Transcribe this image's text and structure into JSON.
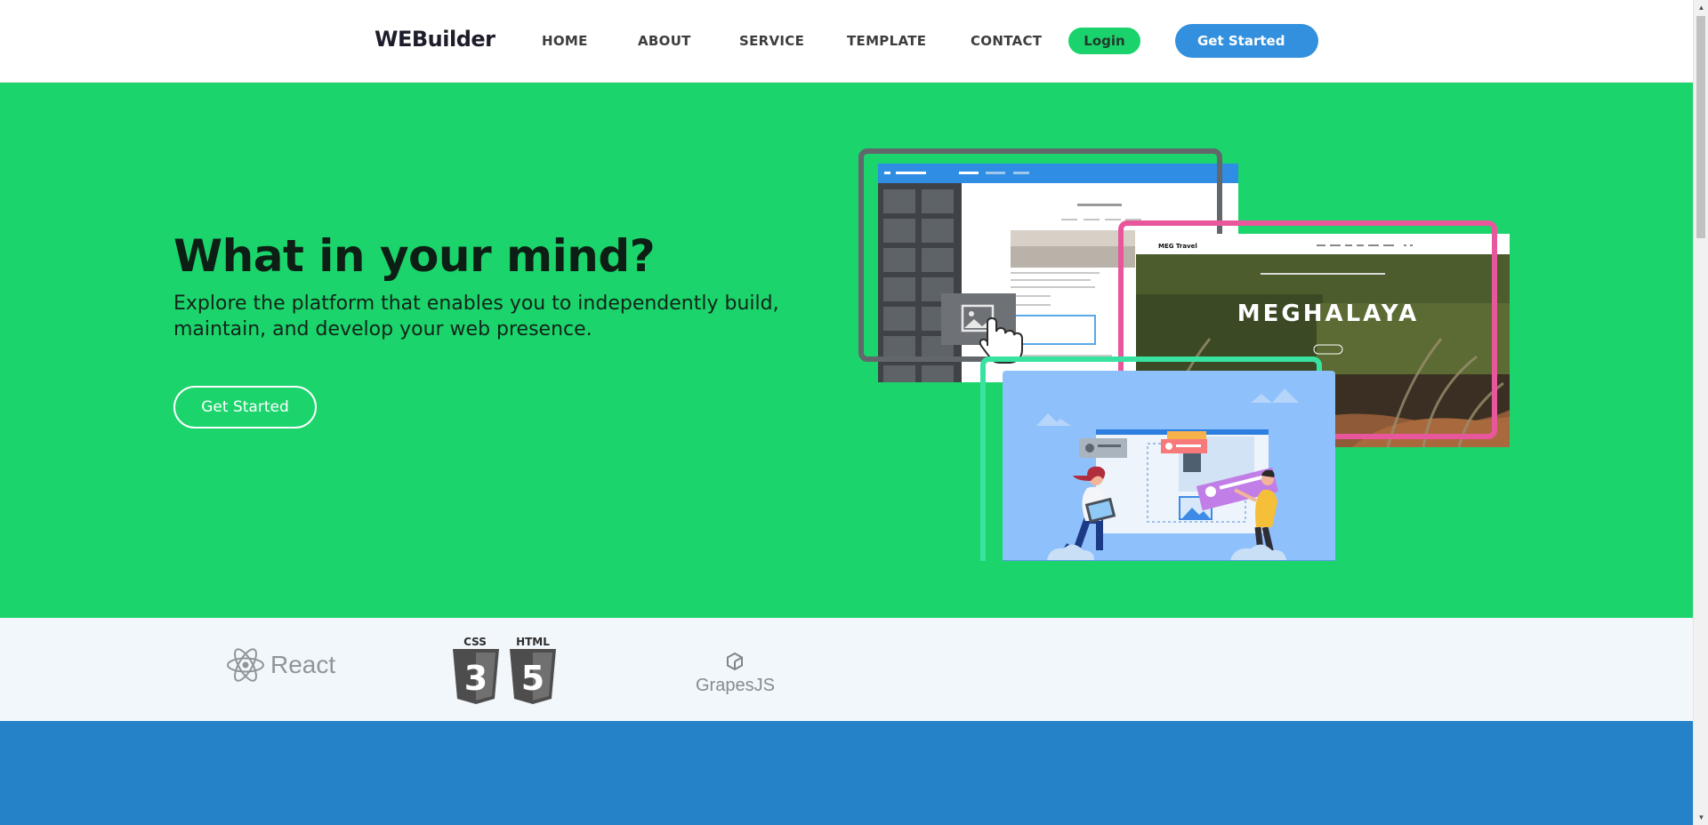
{
  "nav": {
    "brand": "WEBuilder",
    "items": [
      {
        "label": "HOME"
      },
      {
        "label": "ABOUT"
      },
      {
        "label": "SERVICE"
      },
      {
        "label": "TEMPLATE"
      },
      {
        "label": "CONTACT"
      }
    ],
    "login_label": "Login",
    "get_started_label": "Get Started"
  },
  "hero": {
    "title": "What in your mind?",
    "subtitle_line1": "Explore the platform that enables you to independently build,",
    "subtitle_line2": "maintain, and develop your web presence.",
    "button_label": "Get Started",
    "illustration": {
      "travel_brand": "MEG Travel",
      "travel_heading": "MEGHALAYA"
    }
  },
  "logos": {
    "react": "React",
    "css_badge": "CSS",
    "html_badge": "HTML",
    "css_number": "3",
    "html_number": "5",
    "grapes": "GrapesJS"
  },
  "colors": {
    "hero_bg": "#1bd46b",
    "primary_blue": "#3290de",
    "login_green": "#1bd36c",
    "logo_strip_bg": "#f2f7fc",
    "footer_band": "#2582c8"
  }
}
